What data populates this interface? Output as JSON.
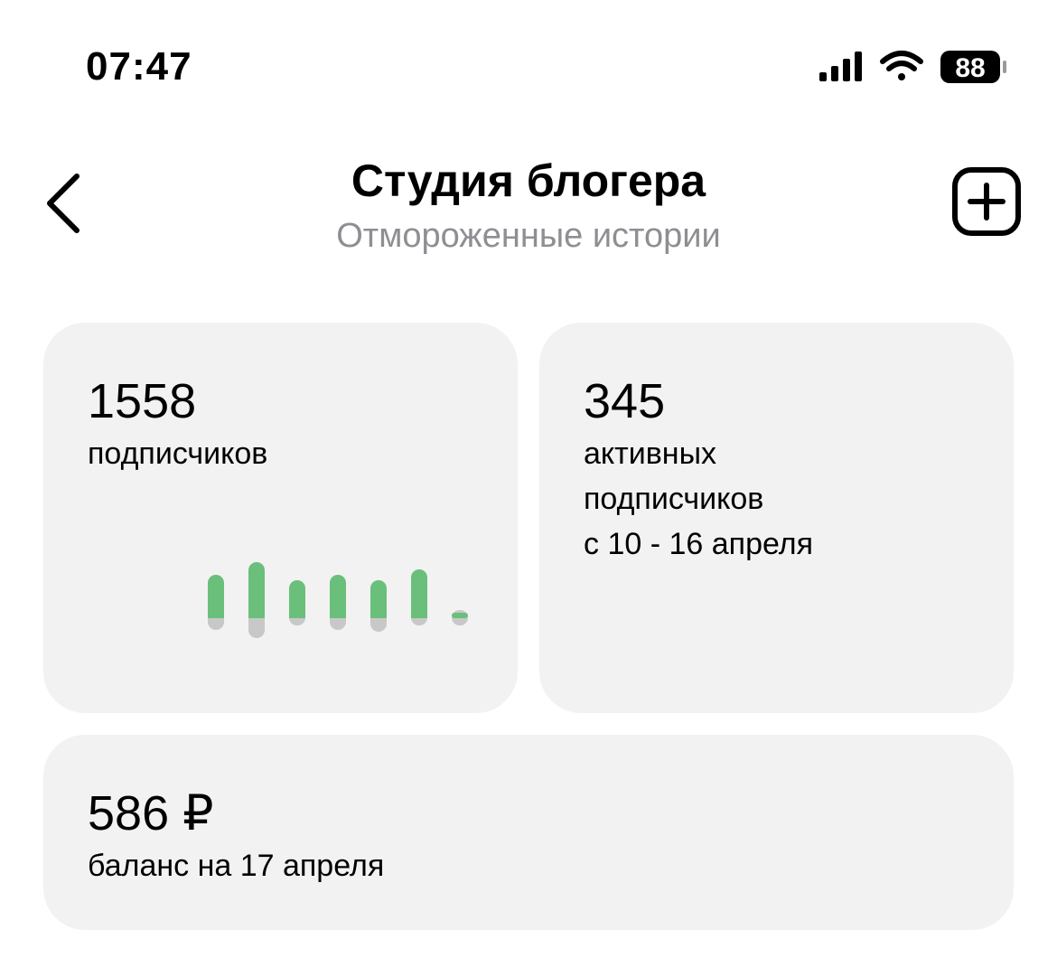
{
  "status_bar": {
    "time": "07:47",
    "battery_level": "88",
    "icons": [
      "signal-icon",
      "wifi-icon",
      "battery-icon"
    ]
  },
  "header": {
    "title": "Студия блогера",
    "subtitle": "Отмороженные истории",
    "back_icon": "chevron-left-icon",
    "add_icon": "plus-square-icon"
  },
  "cards": {
    "subscribers": {
      "value": "1558",
      "caption": "подписчиков"
    },
    "active": {
      "value": "345",
      "caption_line1": "активных",
      "caption_line2": "подписчиков",
      "caption_line3": "с 10 - 16 апреля"
    },
    "balance": {
      "value": "586 ₽",
      "caption": "баланс на 17 апреля"
    }
  },
  "chart_data": {
    "type": "bar",
    "categories": [
      "1",
      "2",
      "3",
      "4",
      "5",
      "6",
      "7"
    ],
    "series": [
      {
        "values": [
          48,
          62,
          42,
          48,
          42,
          54,
          6
        ]
      },
      {
        "values": [
          -13,
          -22,
          -8,
          -13,
          -15,
          -8,
          -8
        ]
      }
    ],
    "colors": {
      "positive": "#6abf7b",
      "negative": "#c8c8c8"
    },
    "grid": false
  },
  "colors": {
    "background": "#ffffff",
    "card": "#f2f2f2",
    "subtitle": "#8e8e93",
    "text": "#000000"
  }
}
